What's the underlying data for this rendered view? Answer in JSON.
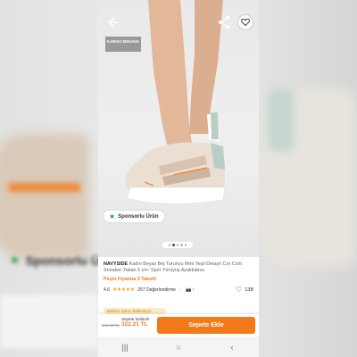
{
  "badges": {
    "kargo": "KARGO BEDAVA",
    "sponsored": "Sponsorlu Ürün"
  },
  "icons": {
    "back": "back-arrow-icon",
    "share": "share-icon",
    "favorite": "heart-icon",
    "star": "star-icon",
    "camera": "camera-icon"
  },
  "product": {
    "brand": "NAVYSIDE",
    "name": "Kadın Beyaz Bej Turuncu Mint Yeşil Detaylı Cırt Cırtlı Sneaker-Taban 5 cm- Spor Yürüyüş Ayakkabısı",
    "campaign": "Peşin Fiyatına 3 Taksit!",
    "rating": "4.6",
    "stars": "★★★★★",
    "review_count": "257 Değerlendirme",
    "favorite_count": "13B",
    "promo_strip": "Belirsiz Satıcı Bekleniyor"
  },
  "buybar": {
    "old_price": "644.42 TL",
    "discount_label": "Sepete İndirimli",
    "discount_price": "322.21 TL",
    "add_to_cart": "Sepete Ekle"
  },
  "gallery": {
    "total_dots": 5,
    "active_index": 1
  },
  "colors": {
    "accent": "#f27a1a",
    "sponsor_star": "#2ea043",
    "rating_star": "#f5a623"
  },
  "android_nav": {
    "recents": "|||",
    "home": "○",
    "back": "‹"
  }
}
